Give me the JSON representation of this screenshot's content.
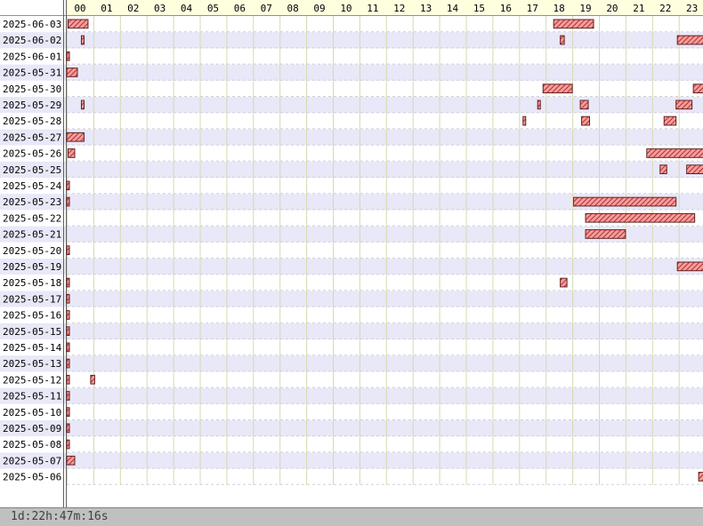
{
  "chart_data": {
    "type": "gantt",
    "x_unit": "hour of day",
    "hours": [
      "00",
      "01",
      "02",
      "03",
      "04",
      "05",
      "06",
      "07",
      "08",
      "09",
      "10",
      "11",
      "12",
      "13",
      "14",
      "15",
      "16",
      "17",
      "18",
      "19",
      "20",
      "21",
      "22",
      "23"
    ],
    "dates": [
      "2025-06-03",
      "2025-06-02",
      "2025-06-01",
      "2025-05-31",
      "2025-05-30",
      "2025-05-29",
      "2025-05-28",
      "2025-05-27",
      "2025-05-26",
      "2025-05-25",
      "2025-05-24",
      "2025-05-23",
      "2025-05-22",
      "2025-05-21",
      "2025-05-20",
      "2025-05-19",
      "2025-05-18",
      "2025-05-17",
      "2025-05-16",
      "2025-05-15",
      "2025-05-14",
      "2025-05-13",
      "2025-05-12",
      "2025-05-11",
      "2025-05-10",
      "2025-05-09",
      "2025-05-08",
      "2025-05-07",
      "2025-05-06"
    ],
    "intervals": {
      "2025-06-03": [
        [
          0.05,
          0.8
        ],
        [
          18.3,
          19.8
        ]
      ],
      "2025-06-02": [
        [
          0.55,
          0.65
        ],
        [
          18.55,
          18.7
        ],
        [
          22.95,
          24
        ]
      ],
      "2025-06-01": [
        [
          0,
          0.1
        ]
      ],
      "2025-05-31": [
        [
          0,
          0.4
        ]
      ],
      "2025-05-30": [
        [
          17.9,
          19.0
        ],
        [
          23.55,
          24
        ]
      ],
      "2025-05-29": [
        [
          0.55,
          0.65
        ],
        [
          17.7,
          17.8
        ],
        [
          19.3,
          19.6
        ],
        [
          22.9,
          23.5
        ]
      ],
      "2025-05-28": [
        [
          17.15,
          17.25
        ],
        [
          19.35,
          19.65
        ],
        [
          22.45,
          22.9
        ]
      ],
      "2025-05-27": [
        [
          0,
          0.65
        ]
      ],
      "2025-05-26": [
        [
          0.05,
          0.3
        ],
        [
          21.8,
          24
        ]
      ],
      "2025-05-25": [
        [
          22.3,
          22.55
        ],
        [
          23.3,
          24
        ]
      ],
      "2025-05-24": [
        [
          0,
          0.1
        ]
      ],
      "2025-05-23": [
        [
          0,
          0.1
        ],
        [
          19.05,
          22.9
        ]
      ],
      "2025-05-22": [
        [
          19.5,
          23.6
        ]
      ],
      "2025-05-21": [
        [
          19.5,
          21.0
        ]
      ],
      "2025-05-20": [
        [
          0,
          0.1
        ]
      ],
      "2025-05-19": [
        [
          22.95,
          24
        ]
      ],
      "2025-05-18": [
        [
          0,
          0.1
        ],
        [
          18.55,
          18.8
        ]
      ],
      "2025-05-17": [
        [
          0,
          0.1
        ]
      ],
      "2025-05-16": [
        [
          0,
          0.1
        ]
      ],
      "2025-05-15": [
        [
          0,
          0.1
        ]
      ],
      "2025-05-14": [
        [
          0,
          0.1
        ]
      ],
      "2025-05-13": [
        [
          0,
          0.1
        ]
      ],
      "2025-05-12": [
        [
          0,
          0.1
        ],
        [
          0.9,
          1.05
        ]
      ],
      "2025-05-11": [
        [
          0,
          0.1
        ]
      ],
      "2025-05-10": [
        [
          0,
          0.1
        ]
      ],
      "2025-05-09": [
        [
          0,
          0.1
        ]
      ],
      "2025-05-08": [
        [
          0,
          0.1
        ]
      ],
      "2025-05-07": [
        [
          0,
          0.3
        ]
      ],
      "2025-05-06": [
        [
          23.75,
          23.95
        ]
      ]
    },
    "colors": {
      "bar_fill": "#ff9999",
      "bar_stroke": "#602020",
      "header_bg": "#ffffe0",
      "row_alt": "#e8e8f8",
      "row": "#ffffff"
    }
  },
  "footer": {
    "total": "1d:22h:47m:16s"
  }
}
